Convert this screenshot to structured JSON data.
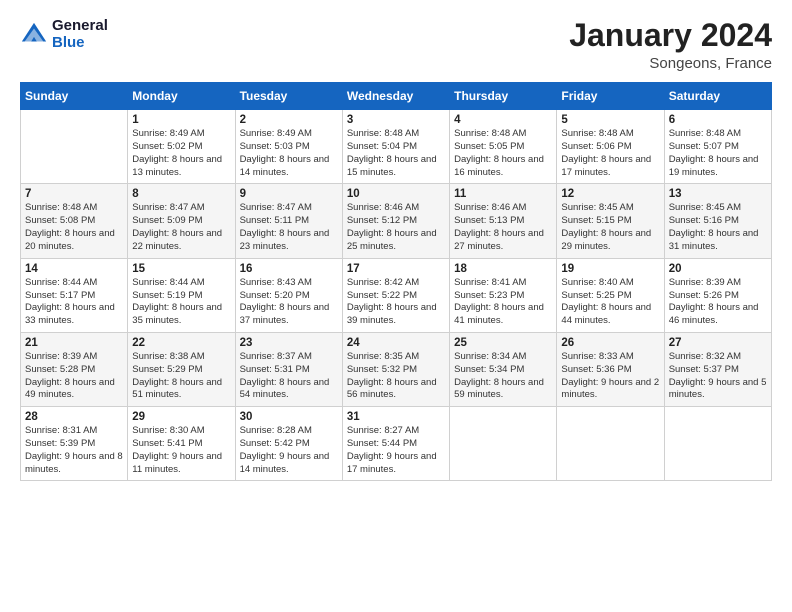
{
  "logo": {
    "general": "General",
    "blue": "Blue"
  },
  "title": "January 2024",
  "subtitle": "Songeons, France",
  "days_header": [
    "Sunday",
    "Monday",
    "Tuesday",
    "Wednesday",
    "Thursday",
    "Friday",
    "Saturday"
  ],
  "weeks": [
    [
      {
        "day": "",
        "sunrise": "",
        "sunset": "",
        "daylight": ""
      },
      {
        "day": "1",
        "sunrise": "Sunrise: 8:49 AM",
        "sunset": "Sunset: 5:02 PM",
        "daylight": "Daylight: 8 hours and 13 minutes."
      },
      {
        "day": "2",
        "sunrise": "Sunrise: 8:49 AM",
        "sunset": "Sunset: 5:03 PM",
        "daylight": "Daylight: 8 hours and 14 minutes."
      },
      {
        "day": "3",
        "sunrise": "Sunrise: 8:48 AM",
        "sunset": "Sunset: 5:04 PM",
        "daylight": "Daylight: 8 hours and 15 minutes."
      },
      {
        "day": "4",
        "sunrise": "Sunrise: 8:48 AM",
        "sunset": "Sunset: 5:05 PM",
        "daylight": "Daylight: 8 hours and 16 minutes."
      },
      {
        "day": "5",
        "sunrise": "Sunrise: 8:48 AM",
        "sunset": "Sunset: 5:06 PM",
        "daylight": "Daylight: 8 hours and 17 minutes."
      },
      {
        "day": "6",
        "sunrise": "Sunrise: 8:48 AM",
        "sunset": "Sunset: 5:07 PM",
        "daylight": "Daylight: 8 hours and 19 minutes."
      }
    ],
    [
      {
        "day": "7",
        "sunrise": "Sunrise: 8:48 AM",
        "sunset": "Sunset: 5:08 PM",
        "daylight": "Daylight: 8 hours and 20 minutes."
      },
      {
        "day": "8",
        "sunrise": "Sunrise: 8:47 AM",
        "sunset": "Sunset: 5:09 PM",
        "daylight": "Daylight: 8 hours and 22 minutes."
      },
      {
        "day": "9",
        "sunrise": "Sunrise: 8:47 AM",
        "sunset": "Sunset: 5:11 PM",
        "daylight": "Daylight: 8 hours and 23 minutes."
      },
      {
        "day": "10",
        "sunrise": "Sunrise: 8:46 AM",
        "sunset": "Sunset: 5:12 PM",
        "daylight": "Daylight: 8 hours and 25 minutes."
      },
      {
        "day": "11",
        "sunrise": "Sunrise: 8:46 AM",
        "sunset": "Sunset: 5:13 PM",
        "daylight": "Daylight: 8 hours and 27 minutes."
      },
      {
        "day": "12",
        "sunrise": "Sunrise: 8:45 AM",
        "sunset": "Sunset: 5:15 PM",
        "daylight": "Daylight: 8 hours and 29 minutes."
      },
      {
        "day": "13",
        "sunrise": "Sunrise: 8:45 AM",
        "sunset": "Sunset: 5:16 PM",
        "daylight": "Daylight: 8 hours and 31 minutes."
      }
    ],
    [
      {
        "day": "14",
        "sunrise": "Sunrise: 8:44 AM",
        "sunset": "Sunset: 5:17 PM",
        "daylight": "Daylight: 8 hours and 33 minutes."
      },
      {
        "day": "15",
        "sunrise": "Sunrise: 8:44 AM",
        "sunset": "Sunset: 5:19 PM",
        "daylight": "Daylight: 8 hours and 35 minutes."
      },
      {
        "day": "16",
        "sunrise": "Sunrise: 8:43 AM",
        "sunset": "Sunset: 5:20 PM",
        "daylight": "Daylight: 8 hours and 37 minutes."
      },
      {
        "day": "17",
        "sunrise": "Sunrise: 8:42 AM",
        "sunset": "Sunset: 5:22 PM",
        "daylight": "Daylight: 8 hours and 39 minutes."
      },
      {
        "day": "18",
        "sunrise": "Sunrise: 8:41 AM",
        "sunset": "Sunset: 5:23 PM",
        "daylight": "Daylight: 8 hours and 41 minutes."
      },
      {
        "day": "19",
        "sunrise": "Sunrise: 8:40 AM",
        "sunset": "Sunset: 5:25 PM",
        "daylight": "Daylight: 8 hours and 44 minutes."
      },
      {
        "day": "20",
        "sunrise": "Sunrise: 8:39 AM",
        "sunset": "Sunset: 5:26 PM",
        "daylight": "Daylight: 8 hours and 46 minutes."
      }
    ],
    [
      {
        "day": "21",
        "sunrise": "Sunrise: 8:39 AM",
        "sunset": "Sunset: 5:28 PM",
        "daylight": "Daylight: 8 hours and 49 minutes."
      },
      {
        "day": "22",
        "sunrise": "Sunrise: 8:38 AM",
        "sunset": "Sunset: 5:29 PM",
        "daylight": "Daylight: 8 hours and 51 minutes."
      },
      {
        "day": "23",
        "sunrise": "Sunrise: 8:37 AM",
        "sunset": "Sunset: 5:31 PM",
        "daylight": "Daylight: 8 hours and 54 minutes."
      },
      {
        "day": "24",
        "sunrise": "Sunrise: 8:35 AM",
        "sunset": "Sunset: 5:32 PM",
        "daylight": "Daylight: 8 hours and 56 minutes."
      },
      {
        "day": "25",
        "sunrise": "Sunrise: 8:34 AM",
        "sunset": "Sunset: 5:34 PM",
        "daylight": "Daylight: 8 hours and 59 minutes."
      },
      {
        "day": "26",
        "sunrise": "Sunrise: 8:33 AM",
        "sunset": "Sunset: 5:36 PM",
        "daylight": "Daylight: 9 hours and 2 minutes."
      },
      {
        "day": "27",
        "sunrise": "Sunrise: 8:32 AM",
        "sunset": "Sunset: 5:37 PM",
        "daylight": "Daylight: 9 hours and 5 minutes."
      }
    ],
    [
      {
        "day": "28",
        "sunrise": "Sunrise: 8:31 AM",
        "sunset": "Sunset: 5:39 PM",
        "daylight": "Daylight: 9 hours and 8 minutes."
      },
      {
        "day": "29",
        "sunrise": "Sunrise: 8:30 AM",
        "sunset": "Sunset: 5:41 PM",
        "daylight": "Daylight: 9 hours and 11 minutes."
      },
      {
        "day": "30",
        "sunrise": "Sunrise: 8:28 AM",
        "sunset": "Sunset: 5:42 PM",
        "daylight": "Daylight: 9 hours and 14 minutes."
      },
      {
        "day": "31",
        "sunrise": "Sunrise: 8:27 AM",
        "sunset": "Sunset: 5:44 PM",
        "daylight": "Daylight: 9 hours and 17 minutes."
      },
      {
        "day": "",
        "sunrise": "",
        "sunset": "",
        "daylight": ""
      },
      {
        "day": "",
        "sunrise": "",
        "sunset": "",
        "daylight": ""
      },
      {
        "day": "",
        "sunrise": "",
        "sunset": "",
        "daylight": ""
      }
    ]
  ]
}
